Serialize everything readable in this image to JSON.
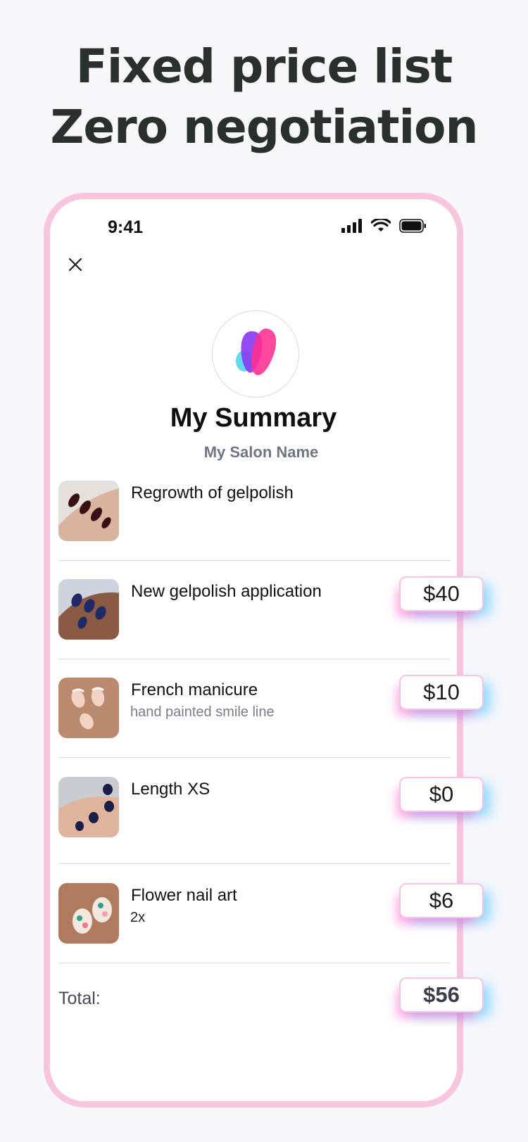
{
  "headline": {
    "line1": "Fixed price list",
    "line2": "Zero negotiation"
  },
  "status_bar": {
    "time": "9:41",
    "icons": [
      "signal-icon",
      "wifi-icon",
      "battery-icon"
    ]
  },
  "screen": {
    "title": "My Summary",
    "salon_name": "My Salon Name",
    "items": [
      {
        "name": "Regrowth of gelpolish",
        "detail": "",
        "price": "",
        "thumb": "dark-burgundy-nails"
      },
      {
        "name": "New gelpolish application",
        "detail": "",
        "price": "$40",
        "thumb": "navy-glitter-nails"
      },
      {
        "name": "French manicure",
        "detail": "hand painted smile line",
        "price": "$10",
        "thumb": "french-nude-nails"
      },
      {
        "name": "Length XS",
        "detail": "",
        "price": "$0",
        "thumb": "short-navy-nails"
      },
      {
        "name": "Flower nail art",
        "detail": "2x",
        "price": "$6",
        "thumb": "flower-art-nails"
      }
    ],
    "total_label": "Total:",
    "total_value": "$56"
  },
  "colors": {
    "phone_border": "#f8c5de",
    "headline": "#2a302b",
    "logo_pink": "#ff2d8f",
    "logo_purple": "#8b3cf0",
    "logo_cyan": "#4dd6f0"
  }
}
